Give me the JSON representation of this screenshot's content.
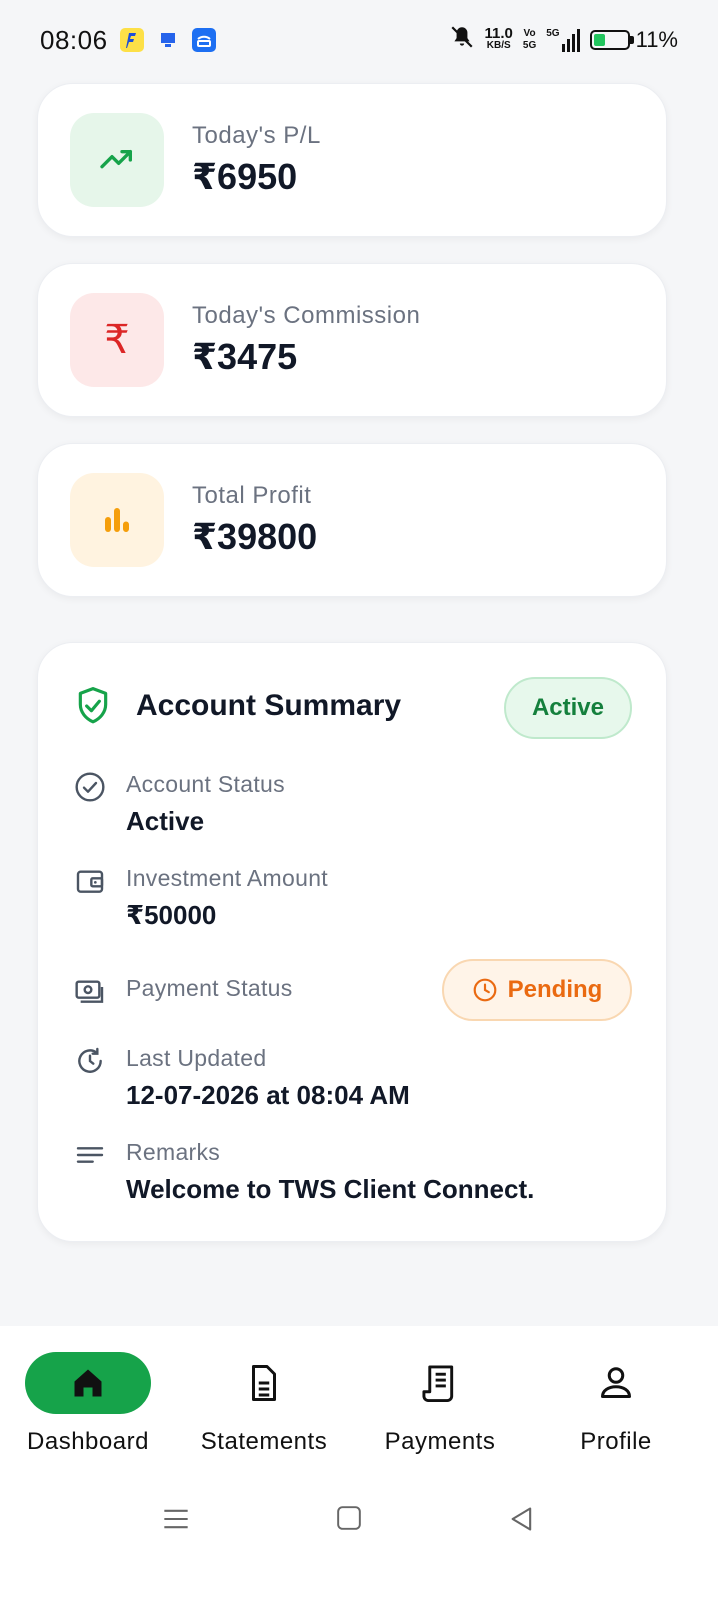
{
  "status_bar": {
    "time": "08:06",
    "net_speed_value": "11.0",
    "net_speed_unit": "KB/S",
    "vo": "Vo",
    "vo_sub": "5G",
    "network": "5G",
    "battery_percent": "11%",
    "battery_level": 0.11
  },
  "stats": [
    {
      "label": "Today's P/L",
      "value": "₹6950",
      "icon": "trend-up-icon",
      "color": "#16a34a",
      "bg": "#e6f6ea"
    },
    {
      "label": "Today's Commission",
      "value": "₹3475",
      "icon": "rupee-icon",
      "color": "#dc2626",
      "bg": "#fde8e8"
    },
    {
      "label": "Total Profit",
      "value": "₹39800",
      "icon": "bar-chart-icon",
      "color": "#f59e0b",
      "bg": "#fff3e0"
    }
  ],
  "summary": {
    "title": "Account Summary",
    "badge": "Active",
    "account_status_label": "Account Status",
    "account_status_value": "Active",
    "investment_label": "Investment Amount",
    "investment_value": "₹50000",
    "payment_label": "Payment Status",
    "payment_value": "Pending",
    "updated_label": "Last Updated",
    "updated_value": "12-07-2026 at 08:04 AM",
    "remarks_label": "Remarks",
    "remarks_value": "Welcome to TWS Client Connect."
  },
  "nav": {
    "dashboard": "Dashboard",
    "statements": "Statements",
    "payments": "Payments",
    "profile": "Profile"
  },
  "colors": {
    "accent": "#16a34a",
    "pending": "#ea6a11"
  }
}
